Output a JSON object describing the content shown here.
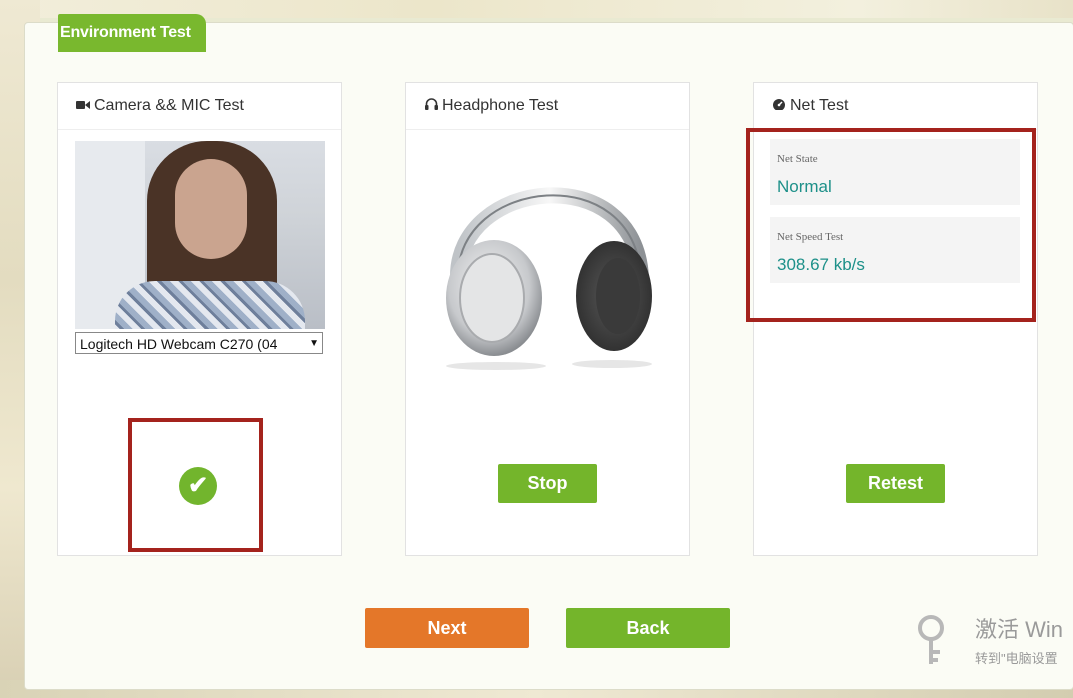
{
  "tab": {
    "label": "Environment Test"
  },
  "camera": {
    "title": "Camera && MIC Test",
    "icon": "video-camera-icon",
    "device_selected": "Logitech HD Webcam C270 (04",
    "status_icon": "check-circle-icon"
  },
  "headphone": {
    "title": "Headphone Test",
    "icon": "headphones-icon",
    "stop_label": "Stop"
  },
  "net": {
    "title": "Net Test",
    "icon": "dashboard-icon",
    "state_label": "Net State",
    "state_value": "Normal",
    "speed_label": "Net Speed Test",
    "speed_value": "308.67 kb/s",
    "retest_label": "Retest"
  },
  "footer": {
    "next_label": "Next",
    "back_label": "Back"
  },
  "watermark": {
    "line1": "激活 Win",
    "line2": "转到\"电脑设置"
  },
  "colors": {
    "green": "#74b52b",
    "orange": "#e47729",
    "teal_value": "#1d9089",
    "highlight_red": "#a4231d"
  }
}
